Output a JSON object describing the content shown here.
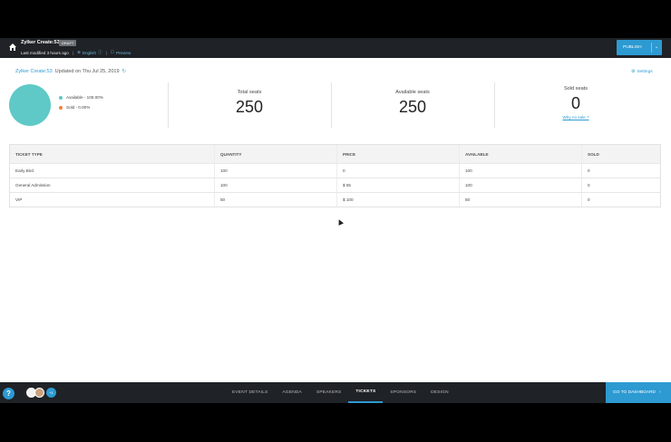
{
  "header": {
    "title": "Zylker Create:53",
    "badge": "DRAFT",
    "last_modified": "Last modified 3 hours ago",
    "language": "English",
    "preview": "Preview",
    "publish": "PUBLISH"
  },
  "event": {
    "name": "Zylker Create:53",
    "updated": "Updated on Thu Jul 25, 2019",
    "settings": "Settings"
  },
  "legend": {
    "available": "Available - 100.00%",
    "sold": "Sold - 0.00%",
    "available_color": "#5ec9c7",
    "sold_color": "#f0803c"
  },
  "chart_data": {
    "type": "pie",
    "categories": [
      "Available",
      "Sold"
    ],
    "values": [
      100.0,
      0.0
    ]
  },
  "stats": {
    "total_label": "Total seats",
    "total_value": "250",
    "available_label": "Available seats",
    "available_value": "250",
    "sold_label": "Sold seats",
    "sold_value": "0",
    "why_link": "Why no sale ?"
  },
  "table": {
    "headers": [
      "TICKET TYPE",
      "QUANTITY",
      "PRICE",
      "AVAILABLE",
      "SOLD"
    ],
    "rows": [
      [
        "Early Bird",
        "100",
        "0",
        "100",
        "0"
      ],
      [
        "General Admission",
        "100",
        "$ 55",
        "100",
        "0"
      ],
      [
        "VIP",
        "50",
        "$ 100",
        "50",
        "0"
      ]
    ]
  },
  "bottom": {
    "help": "?",
    "avatar_count": "+1",
    "tabs": [
      "EVENT DETAILS",
      "AGENDA",
      "SPEAKERS",
      "TICKETS",
      "SPONSORS",
      "DESIGN"
    ],
    "active_tab": "TICKETS",
    "dashboard": "GO TO DASHBOARD"
  },
  "colors": {
    "accent": "#2d9ad2",
    "header_bg": "#1f2226"
  }
}
